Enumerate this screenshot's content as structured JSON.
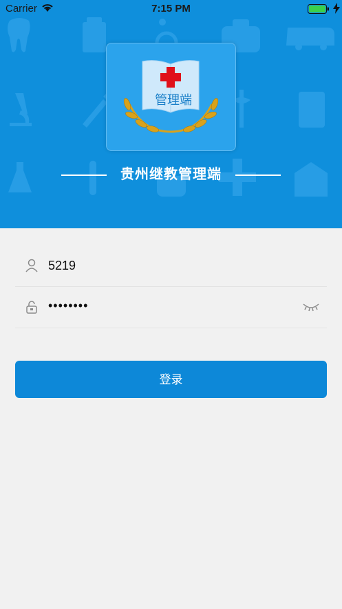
{
  "status_bar": {
    "carrier": "Carrier",
    "time": "7:15 PM"
  },
  "app": {
    "logo_text": "管理端",
    "title": "贵州继教管理端"
  },
  "form": {
    "username": {
      "value": "5219",
      "icon": "user-icon"
    },
    "password": {
      "value": "••••••••",
      "icon": "lock-icon",
      "toggle_icon": "eye-closed-icon"
    }
  },
  "login_button": {
    "label": "登录"
  },
  "colors": {
    "brand_blue": "#0f8fdc",
    "button_blue": "#0d88d8",
    "background": "#f1f1f1",
    "cross_red": "#e0101a",
    "laurel_gold": "#d9a21b"
  }
}
